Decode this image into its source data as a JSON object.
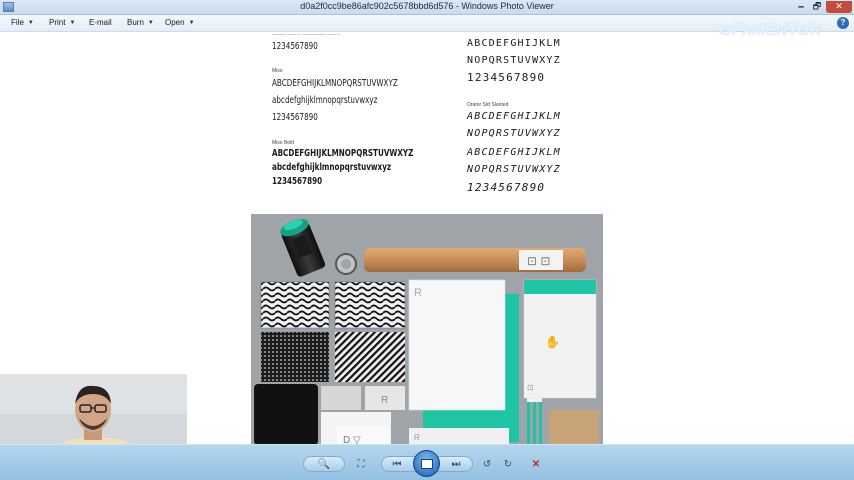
{
  "window": {
    "title": "d0a2f0cc9be86afc902c5678bbd6d576 - Windows Photo Viewer",
    "minimize_glyph": "🗕",
    "maximize_glyph": "🗗",
    "close_glyph": "✕"
  },
  "menu": [
    {
      "label": "File",
      "has_caret": true
    },
    {
      "label": "Print",
      "has_caret": true
    },
    {
      "label": "E-mail",
      "has_caret": false
    },
    {
      "label": "Burn",
      "has_caret": true
    },
    {
      "label": "Open",
      "has_caret": true
    }
  ],
  "help_glyph": "?",
  "watermark": "GFXMENTOR",
  "type_specimen": {
    "left": [
      {
        "lines": [
          "1234567890"
        ],
        "style": "regular"
      },
      {
        "caption": "Miso",
        "lines": [
          "ABCDEFGHIJKLMNOPQRSTUVWXYZ",
          "abcdefghijklmnopqrstuvwxyz",
          "1234567890"
        ],
        "style": "regular"
      },
      {
        "caption": "Miso Bold",
        "lines": [
          "ABCDEFGHIJKLMNOPQRSTUVWXYZ",
          "abcdefghijklmnopqrstuvwxyz",
          "1234567890"
        ],
        "style": "bold"
      }
    ],
    "right": [
      {
        "lines": [
          "ABCDEFGHIJKLM",
          "NOPQRSTUVWXYZ",
          "1234567890"
        ],
        "style": "regular"
      },
      {
        "caption": "Orator Std Slanted",
        "lines": [
          "ABCDEFGHIJKLM",
          "NOPQRSTUVWXYZ",
          "ABCDEFGHIJKLM",
          "NOPQRSTUVWXYZ",
          "1234567890"
        ],
        "style": "italic"
      }
    ]
  },
  "mockup": {
    "card_mark": "R",
    "accent_color": "#19c6a7",
    "tube_color": "#c98e5a"
  },
  "toolbar": {
    "zoom": "🔍",
    "fit": "⛶",
    "prev": "⏮",
    "next": "⏭",
    "rotate_ccw": "↺",
    "rotate_cw": "↻",
    "delete": "✕"
  },
  "cursor": "hand-cursor-icon",
  "colors": {
    "titlebar": "#c9dbee",
    "toolbar": "#a6cbe8",
    "delete": "#c0262b"
  }
}
